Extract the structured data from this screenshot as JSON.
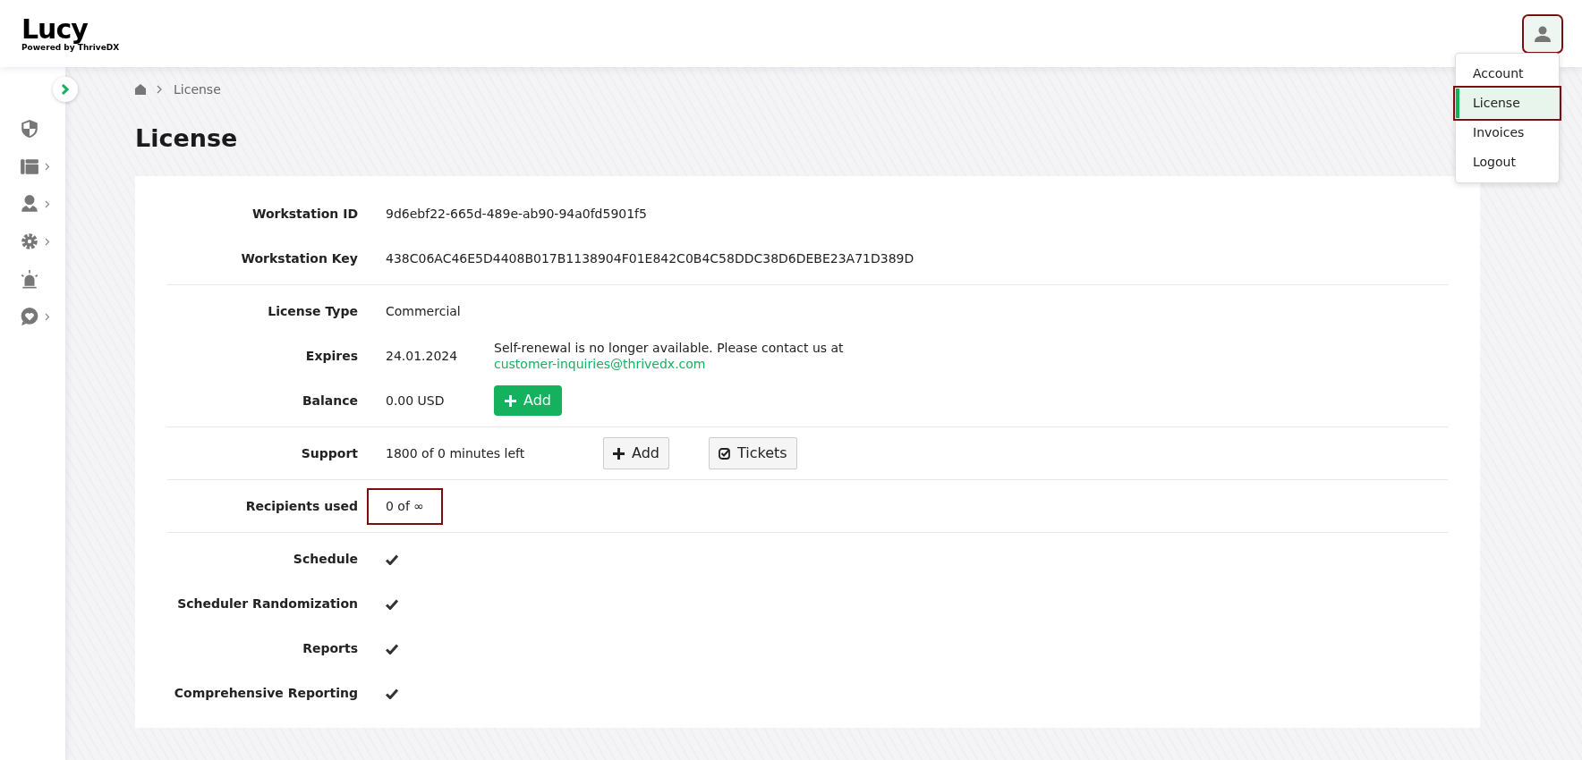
{
  "header": {
    "logo": "Lucy",
    "logo_tagline": "Powered by ThriveDX",
    "user_button": {
      "highlighted": true
    }
  },
  "user_menu": {
    "items": [
      {
        "label": "Account",
        "selected": false,
        "highlighted": false
      },
      {
        "label": "License",
        "selected": true,
        "highlighted": true
      },
      {
        "label": "Invoices",
        "selected": false,
        "highlighted": false
      },
      {
        "label": "Logout",
        "selected": false,
        "highlighted": false
      }
    ]
  },
  "sidebar": {
    "items": [
      {
        "kind": "security",
        "has_submenu": false
      },
      {
        "kind": "layout",
        "has_submenu": true
      },
      {
        "kind": "users",
        "has_submenu": true
      },
      {
        "kind": "settings",
        "has_submenu": true
      },
      {
        "kind": "alarm",
        "has_submenu": false
      },
      {
        "kind": "support",
        "has_submenu": true
      }
    ]
  },
  "breadcrumb": [
    "License"
  ],
  "page_title": "License",
  "sections": [
    [
      {
        "kind": "text",
        "label": "Workstation ID",
        "value": "9d6ebf22-665d-489e-ab90-94a0fd5901f5"
      },
      {
        "kind": "text",
        "label": "Workstation Key",
        "value": "438C06AC46E5D4408B017B1138904F01E842C0B4C58DDC38D6DEBE23A71D389D"
      }
    ],
    [
      {
        "kind": "text",
        "label": "License Type",
        "value": "Commercial"
      },
      {
        "kind": "text",
        "label": "Expires",
        "value": "24.01.2024",
        "note": "Self-renewal is no longer available. Please contact us at",
        "link": "customer-inquiries@thrivedx.com"
      },
      {
        "kind": "text",
        "label": "Balance",
        "value": "0.00 USD",
        "buttons": [
          {
            "label": "Add",
            "kind": "top_up"
          }
        ]
      }
    ],
    [
      {
        "kind": "text",
        "label": "Support",
        "value": "1800 of 0 minutes left",
        "buttons": [
          {
            "label": "Add",
            "kind": "add"
          },
          {
            "label": "Tickets",
            "kind": "tickets"
          }
        ]
      }
    ],
    [
      {
        "kind": "text",
        "label": "Recipients used",
        "value": "0 of ∞",
        "highlighted": true
      }
    ],
    [
      {
        "kind": "check",
        "label": "Schedule",
        "checked": true
      },
      {
        "kind": "check",
        "label": "Scheduler Randomization",
        "checked": true
      },
      {
        "kind": "check",
        "label": "Reports",
        "checked": true
      },
      {
        "kind": "check",
        "label": "Comprehensive Reporting",
        "checked": true
      }
    ]
  ]
}
